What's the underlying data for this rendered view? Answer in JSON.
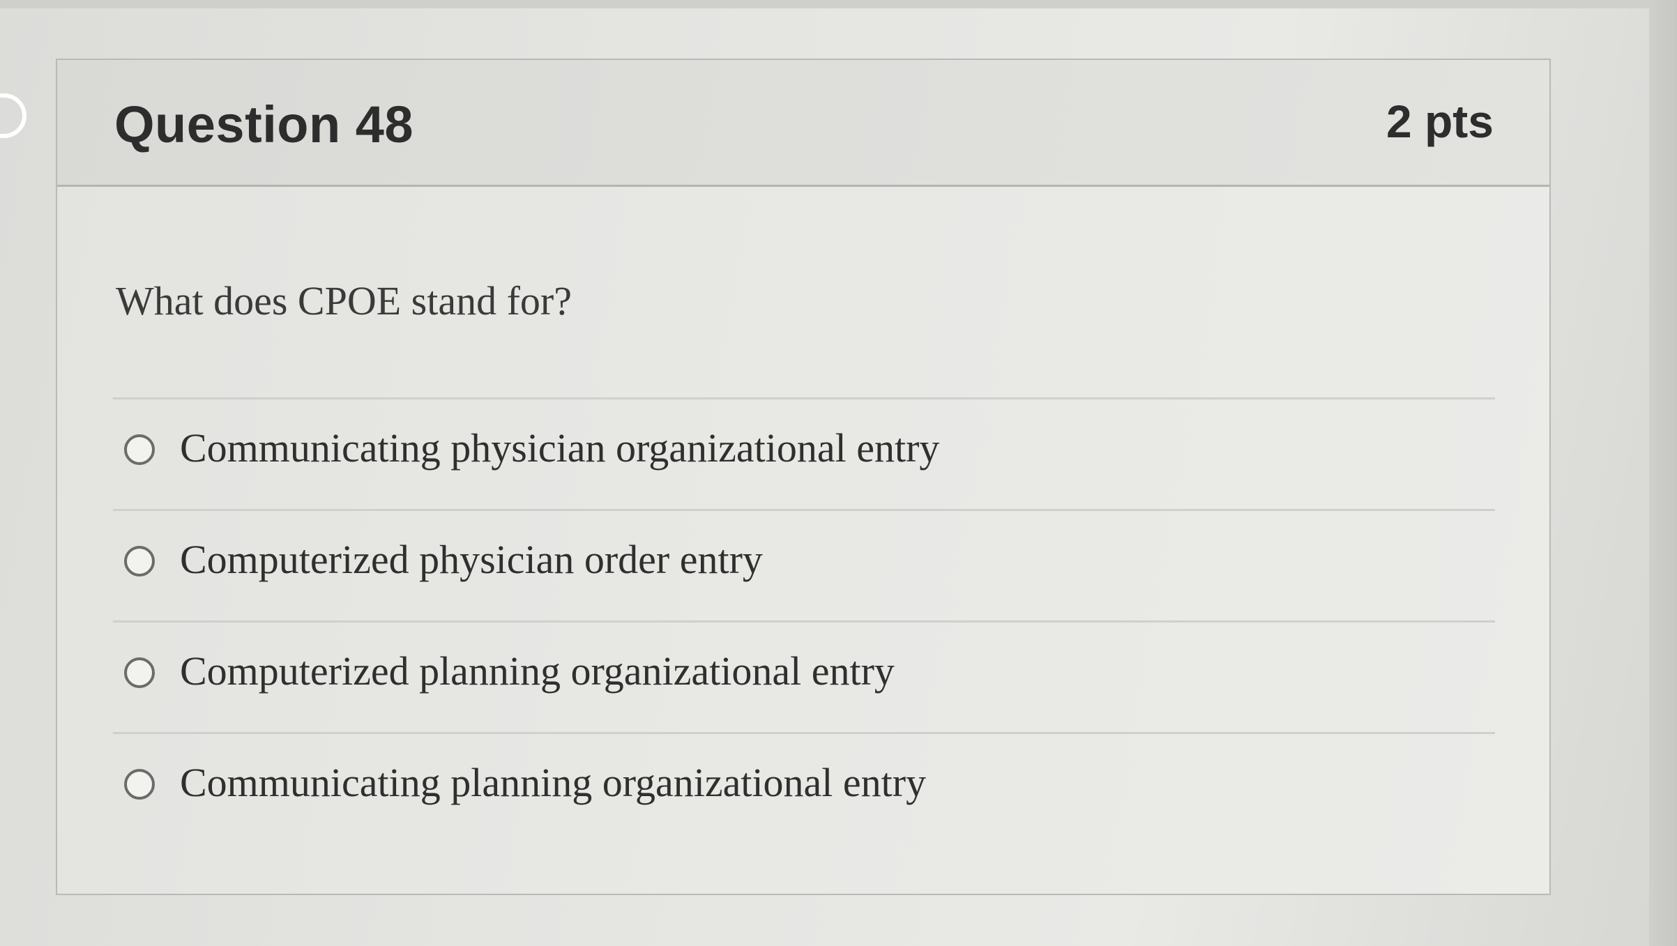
{
  "question": {
    "title": "Question 48",
    "points": "2 pts",
    "text": "What does CPOE stand for?",
    "options": [
      {
        "label": "Communicating physician organizational entry",
        "selected": false
      },
      {
        "label": "Computerized physician order entry",
        "selected": false
      },
      {
        "label": "Computerized planning organizational entry",
        "selected": false
      },
      {
        "label": "Communicating planning organizational entry",
        "selected": false
      }
    ]
  },
  "icons": {
    "nav": "chevron-right-icon",
    "radio": "radio-button-icon"
  },
  "colors": {
    "card_background": "#e8e8e5",
    "header_background": "#dedeDB",
    "text": "#2d2d2d",
    "border": "#b9b9b6"
  }
}
